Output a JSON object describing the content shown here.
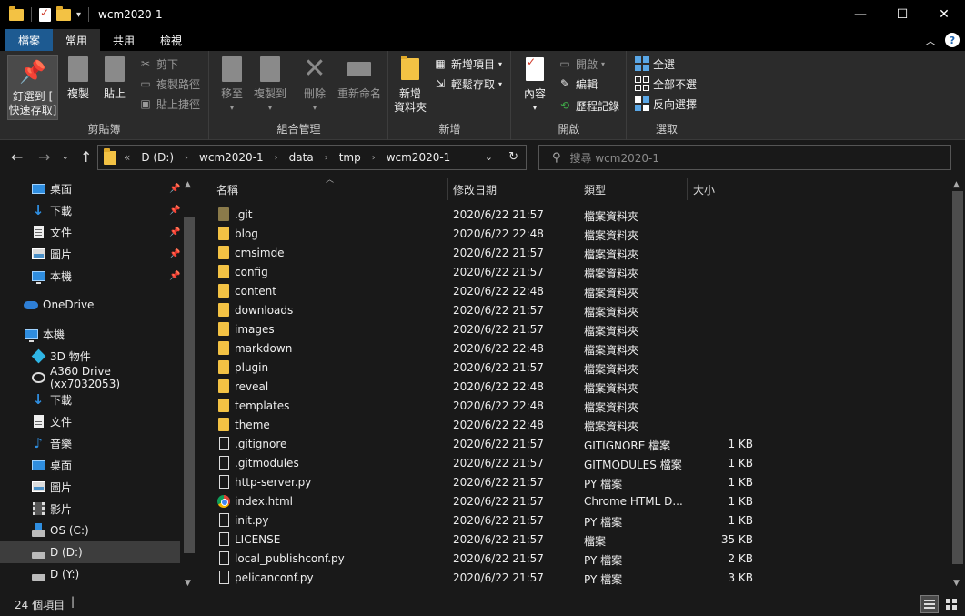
{
  "window": {
    "title": "wcm2020-1",
    "controls": [
      "minimize-icon",
      "maximize-icon",
      "close-icon"
    ]
  },
  "tabs": [
    {
      "label": "檔案",
      "active": false
    },
    {
      "label": "常用",
      "active": true
    },
    {
      "label": "共用",
      "active": false
    },
    {
      "label": "檢視",
      "active": false
    }
  ],
  "ribbon": {
    "clipboard": {
      "label": "剪貼簿",
      "pin": "釘選到 [\n快速存取]",
      "copy": "複製",
      "paste": "貼上",
      "cut": "剪下",
      "copy_path": "複製路徑",
      "paste_shortcut": "貼上捷徑"
    },
    "organize": {
      "label": "組合管理",
      "move_to": "移至",
      "copy_to": "複製到",
      "delete": "刪除",
      "rename": "重新命名"
    },
    "new": {
      "label": "新增",
      "new_folder": "新增\n資料夾",
      "new_item": "新增項目",
      "easy_access": "輕鬆存取"
    },
    "open": {
      "label": "開啟",
      "properties": "內容",
      "open": "開啟",
      "edit": "編輯",
      "history": "歷程記錄"
    },
    "select": {
      "label": "選取",
      "select_all": "全選",
      "select_none": "全部不選",
      "invert": "反向選擇"
    }
  },
  "address": {
    "prefix": "«",
    "crumbs": [
      "D (D:)",
      "wcm2020-1",
      "data",
      "tmp",
      "wcm2020-1"
    ]
  },
  "search": {
    "placeholder": "搜尋 wcm2020-1"
  },
  "nav": [
    {
      "label": "桌面",
      "icon": "desktop-icon",
      "pinned": true
    },
    {
      "label": "下載",
      "icon": "download-icon",
      "pinned": true
    },
    {
      "label": "文件",
      "icon": "document-icon",
      "pinned": true
    },
    {
      "label": "圖片",
      "icon": "picture-icon",
      "pinned": true
    },
    {
      "label": "本機",
      "icon": "computer-icon",
      "pinned": true
    },
    {
      "label": "OneDrive",
      "icon": "onedrive-icon",
      "pinned": false
    },
    {
      "label": "本機",
      "icon": "computer-icon",
      "pinned": false
    },
    {
      "label": "3D 物件",
      "icon": "3d-objects-icon",
      "pinned": false
    },
    {
      "label": "A360 Drive (xx7032053)",
      "icon": "a360-drive-icon",
      "pinned": false
    },
    {
      "label": "下載",
      "icon": "download-icon",
      "pinned": false
    },
    {
      "label": "文件",
      "icon": "document-icon",
      "pinned": false
    },
    {
      "label": "音樂",
      "icon": "music-icon",
      "pinned": false
    },
    {
      "label": "桌面",
      "icon": "desktop-icon",
      "pinned": false
    },
    {
      "label": "圖片",
      "icon": "picture-icon",
      "pinned": false
    },
    {
      "label": "影片",
      "icon": "video-icon",
      "pinned": false
    },
    {
      "label": "OS (C:)",
      "icon": "drive-c-icon",
      "pinned": false
    },
    {
      "label": "D (D:)",
      "icon": "drive-icon",
      "pinned": false,
      "selected": true
    },
    {
      "label": "D (Y:)",
      "icon": "drive-icon",
      "pinned": false
    }
  ],
  "columns": {
    "name": "名稱",
    "modified": "修改日期",
    "type": "類型",
    "size": "大小"
  },
  "files": [
    {
      "name": ".git",
      "modified": "2020/6/22 21:57",
      "type": "檔案資料夾",
      "size": "",
      "icon": "git-folder-icon"
    },
    {
      "name": "blog",
      "modified": "2020/6/22 22:48",
      "type": "檔案資料夾",
      "size": "",
      "icon": "folder-icon"
    },
    {
      "name": "cmsimde",
      "modified": "2020/6/22 21:57",
      "type": "檔案資料夾",
      "size": "",
      "icon": "folder-icon"
    },
    {
      "name": "config",
      "modified": "2020/6/22 21:57",
      "type": "檔案資料夾",
      "size": "",
      "icon": "folder-icon"
    },
    {
      "name": "content",
      "modified": "2020/6/22 22:48",
      "type": "檔案資料夾",
      "size": "",
      "icon": "folder-icon"
    },
    {
      "name": "downloads",
      "modified": "2020/6/22 21:57",
      "type": "檔案資料夾",
      "size": "",
      "icon": "folder-icon"
    },
    {
      "name": "images",
      "modified": "2020/6/22 21:57",
      "type": "檔案資料夾",
      "size": "",
      "icon": "folder-icon"
    },
    {
      "name": "markdown",
      "modified": "2020/6/22 22:48",
      "type": "檔案資料夾",
      "size": "",
      "icon": "folder-icon"
    },
    {
      "name": "plugin",
      "modified": "2020/6/22 21:57",
      "type": "檔案資料夾",
      "size": "",
      "icon": "folder-icon"
    },
    {
      "name": "reveal",
      "modified": "2020/6/22 22:48",
      "type": "檔案資料夾",
      "size": "",
      "icon": "folder-icon"
    },
    {
      "name": "templates",
      "modified": "2020/6/22 22:48",
      "type": "檔案資料夾",
      "size": "",
      "icon": "folder-icon"
    },
    {
      "name": "theme",
      "modified": "2020/6/22 22:48",
      "type": "檔案資料夾",
      "size": "",
      "icon": "folder-icon"
    },
    {
      "name": ".gitignore",
      "modified": "2020/6/22 21:57",
      "type": "GITIGNORE 檔案",
      "size": "1 KB",
      "icon": "file-icon"
    },
    {
      "name": ".gitmodules",
      "modified": "2020/6/22 21:57",
      "type": "GITMODULES 檔案",
      "size": "1 KB",
      "icon": "file-icon"
    },
    {
      "name": "http-server.py",
      "modified": "2020/6/22 21:57",
      "type": "PY 檔案",
      "size": "1 KB",
      "icon": "file-icon"
    },
    {
      "name": "index.html",
      "modified": "2020/6/22 21:57",
      "type": "Chrome HTML D...",
      "size": "1 KB",
      "icon": "chrome-icon"
    },
    {
      "name": "init.py",
      "modified": "2020/6/22 21:57",
      "type": "PY 檔案",
      "size": "1 KB",
      "icon": "file-icon"
    },
    {
      "name": "LICENSE",
      "modified": "2020/6/22 21:57",
      "type": "檔案",
      "size": "35 KB",
      "icon": "file-icon"
    },
    {
      "name": "local_publishconf.py",
      "modified": "2020/6/22 21:57",
      "type": "PY 檔案",
      "size": "2 KB",
      "icon": "file-icon"
    },
    {
      "name": "pelicanconf.py",
      "modified": "2020/6/22 21:57",
      "type": "PY 檔案",
      "size": "3 KB",
      "icon": "file-icon"
    }
  ],
  "status": {
    "count": "24 個項目",
    "separator": "|"
  }
}
